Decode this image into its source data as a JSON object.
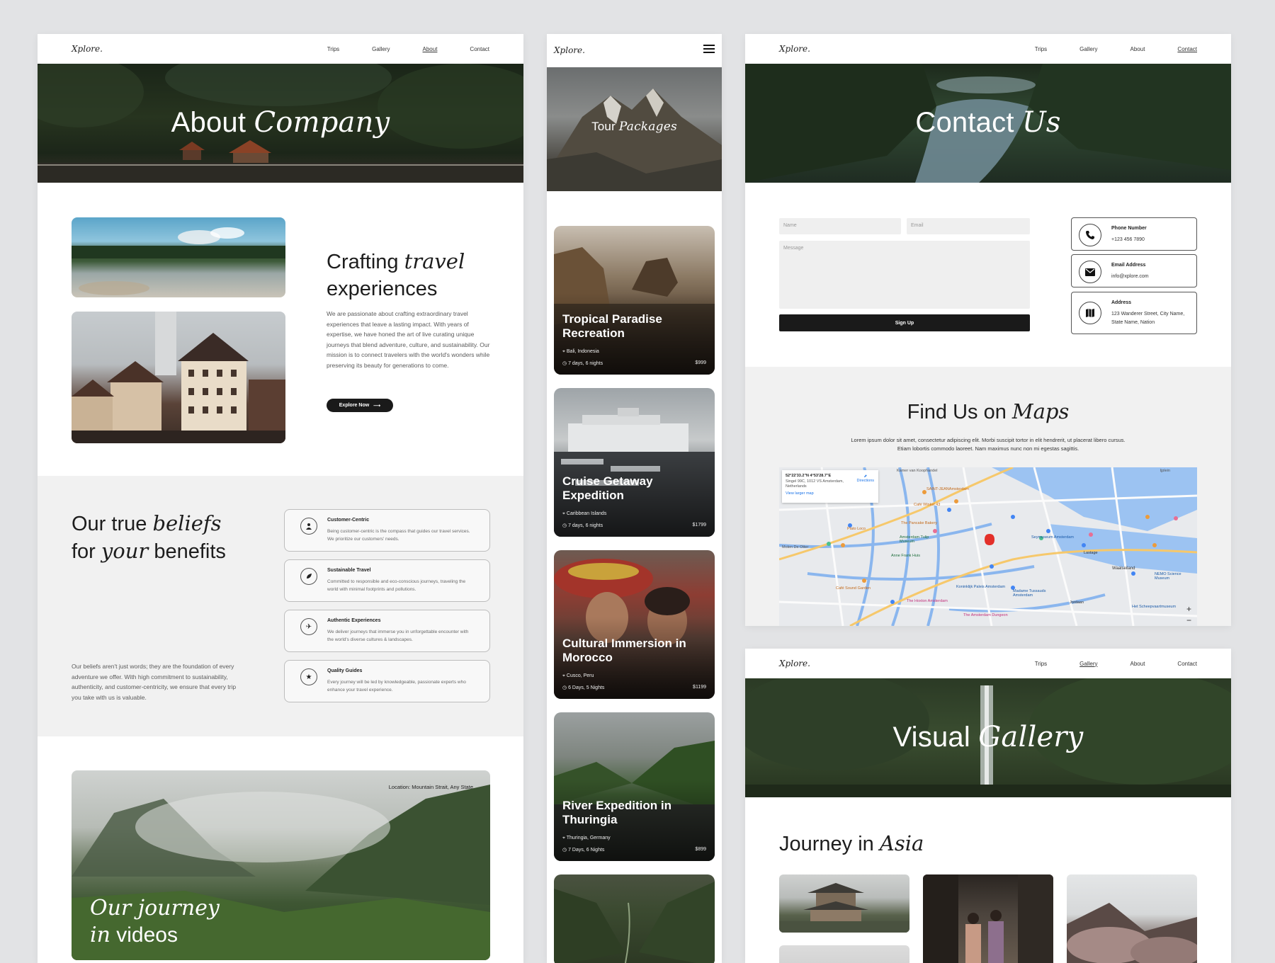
{
  "nav": {
    "logo": "Xplore.",
    "items": [
      "Trips",
      "Gallery",
      "About",
      "Contact"
    ]
  },
  "about_page": {
    "hero_title_plain": "About",
    "hero_title_italic": "Company",
    "crafting_plain_1": "Crafting",
    "crafting_italic": "travel",
    "crafting_plain_2": "experiences",
    "crafting_body": "We are passionate about crafting extraordinary travel experiences that leave a lasting impact. With years of expertise, we have honed the art of live curating unique journeys that blend adventure, culture, and sustainability. Our mission is to connect travelers with the world's wonders while preserving its beauty for generations to come.",
    "explore_label": "Explore Now",
    "beliefs_line1_plain": "Our true",
    "beliefs_line1_italic": "beliefs",
    "beliefs_line2_plain_1": "for",
    "beliefs_line2_italic": "your",
    "beliefs_line2_plain_2": "benefits",
    "beliefs_body": "Our beliefs aren't just words; they are the foundation of every adventure we offer. With high commitment to sustainability, authenticity, and customer-centricity, we ensure that every trip you take with us is valuable.",
    "beliefs": [
      {
        "title": "Customer-Centric",
        "desc": "Being customer-centric is the compass that guides our travel services. We prioritize our customers' needs.",
        "icon": "user-icon"
      },
      {
        "title": "Sustainable Travel",
        "desc": "Committed to responsible and eco-conscious journeys, traveling the world with minimal footprints and pollutions.",
        "icon": "leaf-icon"
      },
      {
        "title": "Authentic Experiences",
        "desc": "We deliver journeys that immerse you in unforgettable encounter with the world's diverse cultures & landscapes.",
        "icon": "plane-icon"
      },
      {
        "title": "Quality Guides",
        "desc": "Every journey will be led by knowledgeable, passionate experts who enhance your travel experience.",
        "icon": "star-icon"
      }
    ],
    "video_location": "Location: Mountain Strait, Any State",
    "video_title_italic_1": "Our journey",
    "video_title_italic_2": "in",
    "video_title_plain": "videos"
  },
  "tour_page": {
    "hero_title_plain": "Tour",
    "hero_title_italic": "Packages",
    "tours": [
      {
        "name": "Tropical Paradise Recreation",
        "location": "Bali, Indonesia",
        "duration": "7 days, 6 nights",
        "price": "$999"
      },
      {
        "name": "Cruise Getaway Expedition",
        "location": "Caribbean Islands",
        "duration": "7 days, 6 nights",
        "price": "$1799"
      },
      {
        "name": "Cultural Immersion in Morocco",
        "location": "Cusco, Peru",
        "duration": "6 Days, 5 Nights",
        "price": "$1199"
      },
      {
        "name": "River Expedition in Thuringia",
        "location": "Thuringia, Germany",
        "duration": "7 Days, 6 Nights",
        "price": "$899"
      }
    ]
  },
  "contact_page": {
    "hero_title_plain": "Contact",
    "hero_title_italic": "Us",
    "name_placeholder": "Name",
    "email_placeholder": "Email",
    "message_placeholder": "Message",
    "submit_label": "Sign Up",
    "info": [
      {
        "title": "Phone Number",
        "value": "+123 456 7890",
        "icon": "phone-icon"
      },
      {
        "title": "Email Address",
        "value": "info@xplore.com",
        "icon": "mail-icon"
      },
      {
        "title": "Address",
        "value": "123 Wanderer Street, City Name, State Name, Nation",
        "icon": "map-icon"
      }
    ],
    "maps_plain": "Find Us on",
    "maps_italic": "Maps",
    "maps_body": "Lorem ipsum dolor sit amet, consectetur adipiscing elit. Morbi suscipit tortor in elit hendrerit, ut placerat libero cursus. Etiam lobortis commodo laoreet. Nam maximus nunc non mi egestas sagittis.",
    "map_coords": "52°22'33.2\"N 4°53'28.7\"E",
    "map_address": "Singel 99C, 1012 VS Amsterdam, Netherlands",
    "map_directions": "Directions",
    "map_larger": "View larger map",
    "map_labels": [
      "SAINT-JEANAmsterdam",
      "Café Winkel 43",
      "The Pancake Bakery",
      "Amsterdam Tulip Museum",
      "Anne Frank Huis",
      "Seymuseum Amsterdam",
      "Museum Ons' Lieve Heer op Solder",
      "Koninklijk Paleis Amsterdam",
      "Madame Tussauds Amsterdam",
      "The Hoxton Amsterdam",
      "Waalseiland",
      "NEMO Science Museum",
      "Het Scheepvaartmuseum",
      "Moco",
      "Café Sound Garden",
      "Plato Loco",
      "Morgan & Mees",
      "De Wallen",
      "Nieuwmarkt",
      "Lastage",
      "Jordaan",
      "Oosterdok",
      "Hotel Port Amsterdam",
      "Bakers & Roasters",
      "The Amsterdam Dungeon",
      "Kamer van Koophandel",
      "Ijplein",
      "Westerpark",
      "Molen De Otter",
      "Frederik Hendrikbuurt",
      "De Bijenkorf",
      "Body Worlds",
      "Movenpick Hotel Amsterdam"
    ]
  },
  "gallery_page": {
    "hero_title_plain": "Visual",
    "hero_title_italic": "Gallery",
    "section_plain": "Journey in",
    "section_italic": "Asia"
  }
}
